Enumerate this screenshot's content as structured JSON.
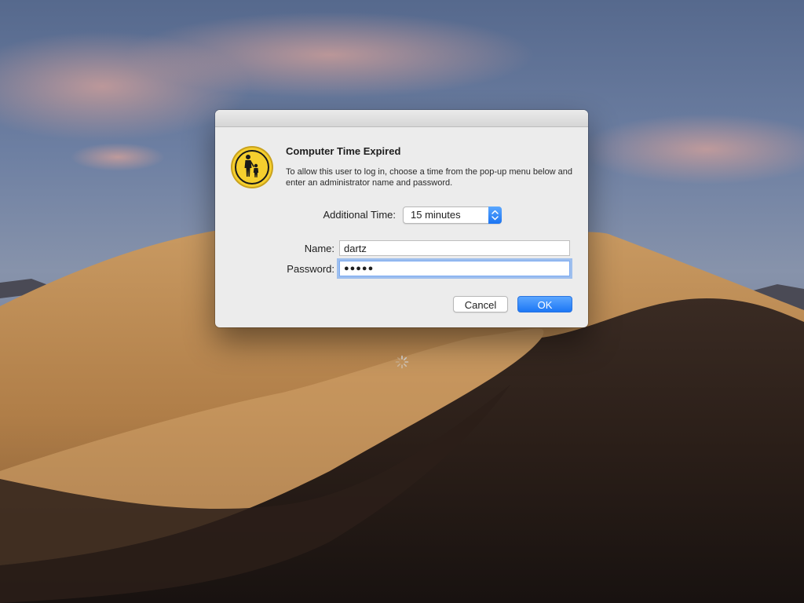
{
  "dialog": {
    "title": "Computer Time Expired",
    "message": "To allow this user to log in, choose a time from the pop-up menu below and enter an administrator name and password.",
    "icon": "parental-controls-icon",
    "additional_time": {
      "label": "Additional Time:",
      "selected": "15 minutes"
    },
    "name": {
      "label": "Name:",
      "value": "dartz"
    },
    "password": {
      "label": "Password:",
      "value": "●●●●●"
    },
    "buttons": {
      "cancel": "Cancel",
      "ok": "OK"
    }
  },
  "colors": {
    "accent": "#1c77f5",
    "dialog_bg": "#ececec",
    "icon_yellow": "#f5cf2e"
  }
}
